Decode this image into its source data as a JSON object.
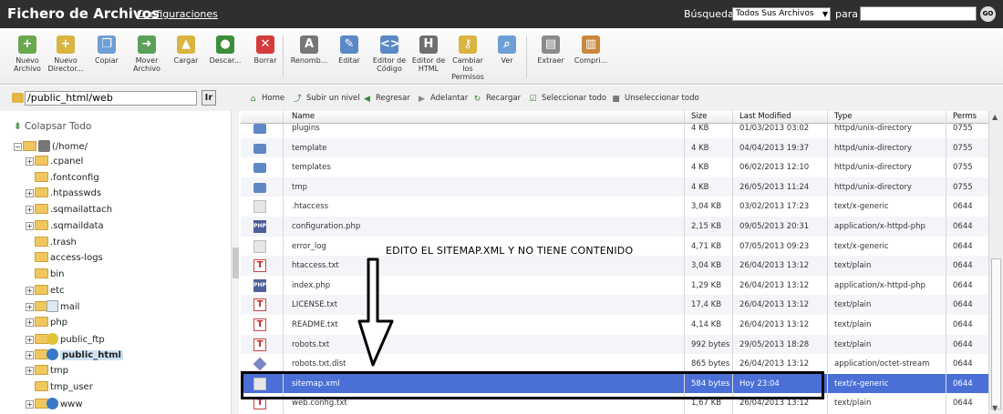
{
  "header": {
    "title": "Fichero de Archivos",
    "config_link": "Configuraciones",
    "search_label": "Búsqueda",
    "search_scope": "Todos Sus Archivos",
    "para_label": "para",
    "go_label": "GO"
  },
  "toolbar": [
    {
      "label": "Nuevo Archivo",
      "icon": "new-file-icon",
      "color": "#6aa84f"
    },
    {
      "label": "Nuevo Director...",
      "icon": "new-folder-icon",
      "color": "#d9b441"
    },
    {
      "label": "Copiar",
      "icon": "copy-icon",
      "color": "#6d9ed6"
    },
    {
      "label": "Mover Archivo",
      "icon": "move-icon",
      "color": "#5aa05a"
    },
    {
      "label": "Cargar",
      "icon": "upload-icon",
      "color": "#d9b441"
    },
    {
      "label": "Descar...",
      "icon": "download-icon",
      "color": "#3b8f3b"
    },
    {
      "label": "Borrar",
      "icon": "delete-icon",
      "color": "#d63b3b"
    },
    {
      "label": "Renomb...",
      "icon": "rename-icon",
      "color": "#777777"
    },
    {
      "label": "Editar",
      "icon": "edit-icon",
      "color": "#5b88c6"
    },
    {
      "label": "Editor de Código",
      "icon": "code-editor-icon",
      "color": "#5b88c6"
    },
    {
      "label": "Editor de HTML",
      "icon": "html-editor-icon",
      "color": "#6f6f6f"
    },
    {
      "label": "Cambiar los Permisos",
      "icon": "key-icon",
      "color": "#d9b441"
    },
    {
      "label": "Ver",
      "icon": "magnifier-icon",
      "color": "#6d9ed6"
    },
    {
      "label": "Extraer",
      "icon": "extract-icon",
      "color": "#8a8a8a"
    },
    {
      "label": "Compri...",
      "icon": "compress-icon",
      "color": "#c9883b"
    }
  ],
  "path": {
    "value": "/public_html/web",
    "go_label": "Ir"
  },
  "nav": [
    {
      "label": "Home",
      "icon": "home-icon"
    },
    {
      "label": "Subir un nivel",
      "icon": "up-level-icon"
    },
    {
      "label": "Regresar",
      "icon": "back-icon"
    },
    {
      "label": "Adelantar",
      "icon": "forward-icon"
    },
    {
      "label": "Recargar",
      "icon": "reload-icon"
    },
    {
      "label": "Seleccionar todo",
      "icon": "select-all-icon"
    },
    {
      "label": "Unseleccionar todo",
      "icon": "unselect-all-icon"
    }
  ],
  "tree": {
    "collapse_label": "Colapsar Todo",
    "root_label": "(/home/",
    "items": [
      {
        "label": ".cpanel",
        "expandable": true
      },
      {
        "label": ".fontconfig",
        "expandable": false
      },
      {
        "label": ".htpasswds",
        "expandable": true
      },
      {
        "label": ".sqmailattach",
        "expandable": true
      },
      {
        "label": ".sqmaildata",
        "expandable": true
      },
      {
        "label": ".trash",
        "expandable": false
      },
      {
        "label": "access-logs",
        "expandable": false
      },
      {
        "label": "bin",
        "expandable": false
      },
      {
        "label": "etc",
        "expandable": true
      },
      {
        "label": "mail",
        "expandable": true
      },
      {
        "label": "php",
        "expandable": true
      },
      {
        "label": "public_ftp",
        "expandable": true
      },
      {
        "label": "public_html",
        "expandable": true
      },
      {
        "label": "tmp",
        "expandable": true
      },
      {
        "label": "tmp_user",
        "expandable": false
      },
      {
        "label": "www",
        "expandable": true
      }
    ]
  },
  "table": {
    "columns": [
      "Name",
      "Size",
      "Last Modified",
      "Type",
      "Perms"
    ],
    "rows": [
      {
        "name": "plugins",
        "size": "4 KB",
        "modified": "01/03/2013 03:02",
        "type": "httpd/unix-directory",
        "perms": "0755",
        "kind": "dir"
      },
      {
        "name": "template",
        "size": "4 KB",
        "modified": "04/04/2013 19:37",
        "type": "httpd/unix-directory",
        "perms": "0755",
        "kind": "dir"
      },
      {
        "name": "templates",
        "size": "4 KB",
        "modified": "06/02/2013 12:10",
        "type": "httpd/unix-directory",
        "perms": "0755",
        "kind": "dir"
      },
      {
        "name": "tmp",
        "size": "4 KB",
        "modified": "26/05/2013 11:24",
        "type": "httpd/unix-directory",
        "perms": "0755",
        "kind": "dir"
      },
      {
        "name": ".htaccess",
        "size": "3,04 KB",
        "modified": "03/02/2013 17:23",
        "type": "text/x-generic",
        "perms": "0644",
        "kind": "doc"
      },
      {
        "name": "configuration.php",
        "size": "2,15 KB",
        "modified": "09/05/2013 20:31",
        "type": "application/x-httpd-php",
        "perms": "0644",
        "kind": "php"
      },
      {
        "name": "error_log",
        "size": "4,71 KB",
        "modified": "07/05/2013 09:23",
        "type": "text/x-generic",
        "perms": "0644",
        "kind": "doc"
      },
      {
        "name": "htaccess.txt",
        "size": "3,04 KB",
        "modified": "26/04/2013 13:12",
        "type": "text/plain",
        "perms": "0644",
        "kind": "txt"
      },
      {
        "name": "index.php",
        "size": "1,29 KB",
        "modified": "26/04/2013 13:12",
        "type": "application/x-httpd-php",
        "perms": "0644",
        "kind": "php"
      },
      {
        "name": "LICENSE.txt",
        "size": "17,4 KB",
        "modified": "26/04/2013 13:12",
        "type": "text/plain",
        "perms": "0644",
        "kind": "txt"
      },
      {
        "name": "README.txt",
        "size": "4,14 KB",
        "modified": "26/04/2013 13:12",
        "type": "text/plain",
        "perms": "0644",
        "kind": "txt"
      },
      {
        "name": "robots.txt",
        "size": "992 bytes",
        "modified": "29/05/2013 18:28",
        "type": "text/plain",
        "perms": "0644",
        "kind": "txt"
      },
      {
        "name": "robots.txt.dist",
        "size": "865 bytes",
        "modified": "26/04/2013 13:12",
        "type": "application/octet-stream",
        "perms": "0644",
        "kind": "dia"
      },
      {
        "name": "sitemap.xml",
        "size": "584 bytes",
        "modified": "Hoy 23:04",
        "type": "text/x-generic",
        "perms": "0644",
        "kind": "doc",
        "selected": true
      },
      {
        "name": "web.config.txt",
        "size": "1,67 KB",
        "modified": "26/04/2013 13:12",
        "type": "text/plain",
        "perms": "0644",
        "kind": "txt"
      }
    ]
  },
  "annotation": {
    "text": "EDITO EL SITEMAP.XML Y NO TIENE CONTENIDO"
  }
}
